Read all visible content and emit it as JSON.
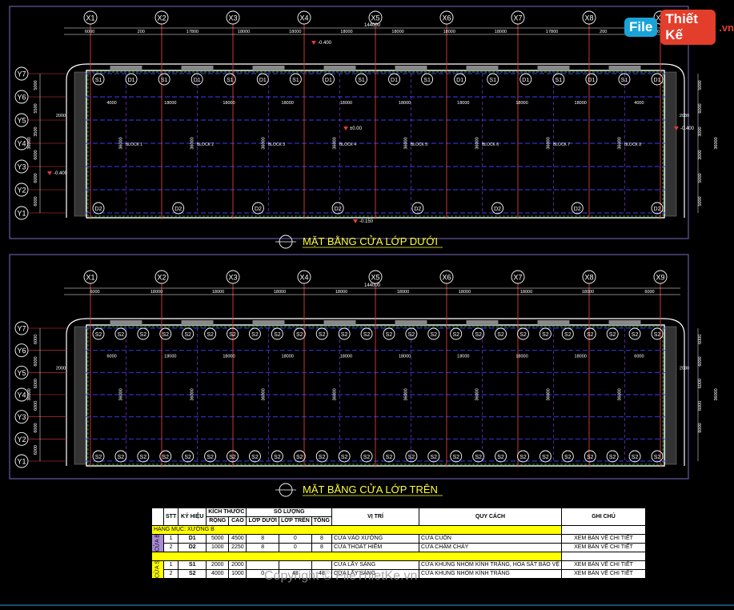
{
  "logo": {
    "part1": "File",
    "part2": "Thiết Kế",
    "domain": ".vn"
  },
  "axes_x": [
    "X1",
    "X2",
    "X3",
    "X4",
    "X5",
    "X6",
    "X7",
    "X8",
    "X9"
  ],
  "axes_y": [
    "Y7",
    "Y6",
    "Y5",
    "Y4",
    "Y3",
    "Y2",
    "Y1"
  ],
  "plan_top": {
    "title": "MẶT BẰNG CỬA LỚP DƯỚI",
    "overall_dim": "144000",
    "dims_top": [
      "6000",
      "200",
      "17800",
      "18000",
      "18000",
      "18000",
      "18000",
      "18000",
      "18000",
      "17800",
      "200",
      "6000"
    ],
    "dims_inner": [
      "4000",
      "18000",
      "18000",
      "18000",
      "18000",
      "18000",
      "18000",
      "18000",
      "18000",
      "4000"
    ],
    "left_dims": [
      "5000",
      "5500",
      "3500",
      "6000",
      "6000",
      "6000",
      "5000"
    ],
    "right_dims": [
      "5000",
      "6000",
      "3000",
      "3000",
      "5000",
      "5000"
    ],
    "side_labels": {
      "left_total": "36000",
      "right_total": "36000",
      "left_2000": "2000",
      "right_2030": "2030"
    },
    "level_labels": [
      "-0.400",
      "±0.00",
      "-0.400",
      "-0.400",
      "-0.150"
    ],
    "blocks": [
      "BLOCK 1",
      "BLOCK 2",
      "BLOCK 3",
      "BLOCK 4",
      "BLOCK 5",
      "BLOCK 6",
      "BLOCK 7",
      "BLOCK 8"
    ],
    "bay_dim": "36000",
    "doors_top_row": [
      "S1",
      "D1",
      "S1",
      "D1",
      "S1",
      "D1",
      "S1",
      "D1",
      "S1",
      "D1",
      "S1",
      "D1",
      "S1",
      "D1",
      "S1",
      "D1",
      "S1",
      "D1"
    ],
    "doors_bottom_row": [
      "D2",
      "D2",
      "D2",
      "D2",
      "D2",
      "D2",
      "D2",
      "D2"
    ]
  },
  "plan_bottom": {
    "title": "MẶT BẰNG CỬA LỚP TRÊN",
    "overall_dim": "144000",
    "dims_top": [
      "6000",
      "18000",
      "18000",
      "18000",
      "18000",
      "18000",
      "18000",
      "18000",
      "18000",
      "6000"
    ],
    "left_dims": [
      "6000",
      "6000",
      "6000",
      "6000",
      "6000",
      "6000"
    ],
    "right_dims": [
      "6000",
      "6000",
      "6000",
      "6000",
      "6000"
    ],
    "side_labels": {
      "left_total": "36000",
      "right_total": "36000",
      "left_2000": "2000",
      "right_2030": "2030"
    },
    "bay_dim": "36000",
    "doors_top_row": [
      "S2",
      "S2",
      "S2",
      "S2",
      "S2",
      "S2",
      "S2",
      "S2",
      "S2",
      "S2",
      "S2",
      "S2",
      "S2",
      "S2",
      "S2",
      "S2",
      "S2",
      "S2",
      "S2",
      "S2",
      "S2",
      "S2",
      "S2",
      "S2",
      "S2",
      "S2"
    ],
    "doors_bottom_row": [
      "S2",
      "S2",
      "S2",
      "S2",
      "S2",
      "S2",
      "S2",
      "S2",
      "S2",
      "S2",
      "S2",
      "S2",
      "S2",
      "S2",
      "S2",
      "S2",
      "S2",
      "S2",
      "S2",
      "S2",
      "S2",
      "S2",
      "S2",
      "S2",
      "S2",
      "S2"
    ]
  },
  "schedule": {
    "headers": {
      "stt": "STT",
      "code": "KÝ HIỆU",
      "size": "KÍCH THƯỚC",
      "width": "RỘNG",
      "height": "CAO",
      "qty": "SỐ LƯỢNG",
      "lower": "LỚP DƯỚI",
      "upper": "LỚP TRÊN",
      "total": "TỔNG",
      "location": "VỊ TRÍ",
      "spec": "QUY CÁCH",
      "note": "GHI CHÚ"
    },
    "section": "HẠNG MỤC: XƯỞNG B",
    "group_b": "CỬA B",
    "group_s": "CỬA S",
    "rows_b": [
      {
        "stt": "1",
        "code": "D1",
        "w": "5000",
        "h": "4500",
        "lower": "8",
        "upper": "0",
        "total": "8",
        "location": "CỬA VÀO XƯỞNG",
        "spec": "CỬA CUỐN",
        "note": "XEM BẢN VẼ CHI TIẾT"
      },
      {
        "stt": "2",
        "code": "D2",
        "w": "1000",
        "h": "2250",
        "lower": "8",
        "upper": "0",
        "total": "8",
        "location": "CỬA THOÁT HIỂM",
        "spec": "CỬA CHẬM CHÁY",
        "note": "XEM BẢN VẼ CHI TIẾT"
      }
    ],
    "rows_s": [
      {
        "stt": "1",
        "code": "S1",
        "w": "2000",
        "h": "2000",
        "lower": "",
        "upper": "",
        "total": "",
        "location": "CỬA LẤY SÁNG",
        "spec": "CỬA KHUNG NHÔM KÍNH TRẮNG, HOA SẮT BẢO VỆ",
        "note": "XEM BẢN VẼ CHI TIẾT"
      },
      {
        "stt": "2",
        "code": "S2",
        "w": "4000",
        "h": "1000",
        "lower": "0",
        "upper": "48",
        "total": "48",
        "location": "CỬA LẤY SÁNG",
        "spec": "CỬA KHUNG NHÔM KÍNH TRẮNG",
        "note": "XEM BẢN VẼ CHI TIẾT"
      }
    ]
  },
  "watermark": "Copyright © FileThietKe.vn",
  "colors": {
    "bg": "#000000",
    "axis": "#e03c3c",
    "grid": "#3c3cff",
    "wall": "#ffffff",
    "green": "#33cc33",
    "title": "#ffff33",
    "dim": "#ffffff"
  }
}
